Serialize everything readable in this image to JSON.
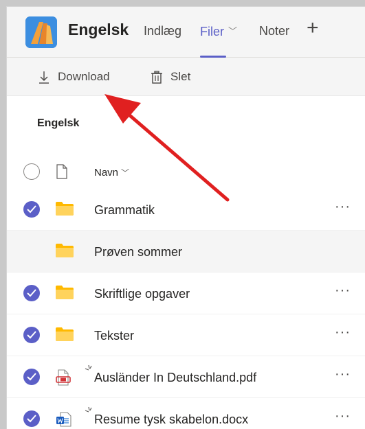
{
  "header": {
    "team_name": "Engelsk",
    "tabs": [
      {
        "label": "Indlæg"
      },
      {
        "label": "Filer",
        "active": true
      },
      {
        "label": "Noter"
      }
    ],
    "add_tab_label": "+"
  },
  "toolbar": {
    "download_label": "Download",
    "delete_label": "Slet"
  },
  "folder_title": "Engelsk",
  "columns": {
    "name_label": "Navn"
  },
  "files": [
    {
      "name": "Grammatik",
      "type": "folder",
      "selected": true
    },
    {
      "name": "Prøven sommer",
      "type": "folder",
      "selected": false
    },
    {
      "name": "Skriftlige opgaver",
      "type": "folder",
      "selected": true
    },
    {
      "name": "Tekster",
      "type": "folder",
      "selected": true
    },
    {
      "name": "Ausländer In Deutschland.pdf",
      "type": "pdf",
      "selected": true
    },
    {
      "name": "Resume tysk skabelon.docx",
      "type": "word",
      "selected": true
    }
  ],
  "more_label": "···",
  "colors": {
    "accent": "#5b5fc7",
    "folder": "#ffb900",
    "annotation_arrow": "#e02020"
  }
}
